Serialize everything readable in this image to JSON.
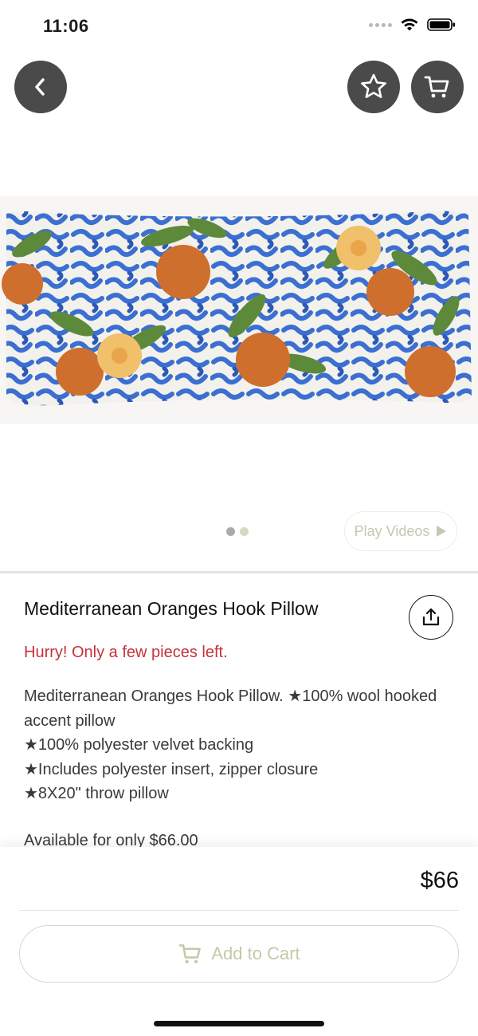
{
  "status_bar": {
    "time": "11:06"
  },
  "header": {
    "back_icon": "chevron-left-icon",
    "favorite_icon": "star-icon",
    "cart_icon": "cart-icon",
    "button_bg": "#4a4a4a"
  },
  "product": {
    "title": "Mediterranean Oranges Hook Pillow",
    "stock_message": "Hurry! Only a few pieces left.",
    "description_lines": [
      "Mediterranean Oranges Hook Pillow. ★100% wool hooked accent pillow",
      "★100% polyester velvet backing",
      "★Includes polyester insert, zipper closure",
      "★8X20\" throw pillow"
    ],
    "availability": "Available for only $66.00",
    "price": "$66"
  },
  "gallery": {
    "play_videos_label": "Play Videos",
    "dot_colors": [
      "#aaaaaa",
      "#d7d9c2"
    ]
  },
  "actions": {
    "add_to_cart_label": "Add to Cart",
    "accent_muted": "#c6c8a8"
  },
  "colors": {
    "stock_warning": "#c7313a"
  }
}
